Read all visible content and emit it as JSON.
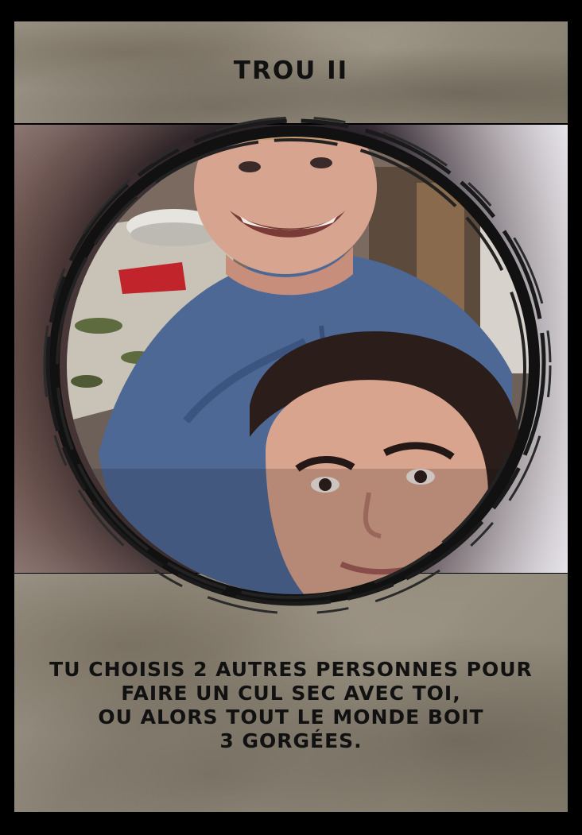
{
  "card": {
    "title": "TROU II",
    "text_lines": [
      "TU CHOISIS 2 AUTRES PERSONNES POUR",
      "FAIRE UN CUL SEC AVEC TOI,",
      "OU ALORS TOUT LE MONDE BOIT",
      "3 GORGÉES."
    ]
  },
  "colors": {
    "frame": "#000000",
    "parchment": "#8f8778",
    "text": "#111111"
  }
}
